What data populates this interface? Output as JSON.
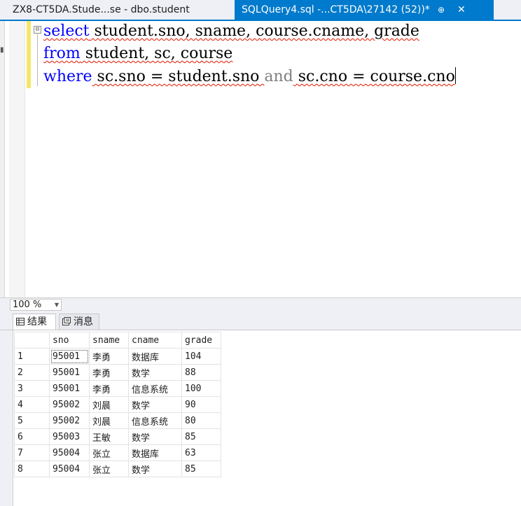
{
  "tabs": {
    "inactive": {
      "title": "ZX8-CT5DA.Stude...se - dbo.student"
    },
    "active": {
      "title": "SQLQuery4.sql -...CT5DA\\27142 (52))*",
      "pin": "⊕",
      "close": "✕"
    }
  },
  "editor": {
    "fold_symbol": "⊟",
    "line1": {
      "kw": "select",
      "rest": " student.sno, sname, course.cname, grade"
    },
    "line2": {
      "kw": "from",
      "rest": " student, sc, course"
    },
    "line3": {
      "kw": "where",
      "part1": " sc.sno = student.sno ",
      "and": "and",
      "part2": " sc.cno = course.cno"
    }
  },
  "zoom": {
    "value": "100 %"
  },
  "results_tabs": {
    "results": {
      "label": "结果",
      "icon": "grid-icon"
    },
    "messages": {
      "label": "消息",
      "icon": "messages-icon"
    }
  },
  "grid": {
    "columns": [
      "",
      "sno",
      "sname",
      "cname",
      "grade"
    ],
    "rows": [
      [
        "1",
        "95001",
        "李勇",
        "数据库",
        "104"
      ],
      [
        "2",
        "95001",
        "李勇",
        "数学",
        "88"
      ],
      [
        "3",
        "95001",
        "李勇",
        "信息系统",
        "100"
      ],
      [
        "4",
        "95002",
        "刘晨",
        "数学",
        "90"
      ],
      [
        "5",
        "95002",
        "刘晨",
        "信息系统",
        "80"
      ],
      [
        "6",
        "95003",
        "王敏",
        "数学",
        "85"
      ],
      [
        "7",
        "95004",
        "张立",
        "数据库",
        "63"
      ],
      [
        "8",
        "95004",
        "张立",
        "数学",
        "85"
      ]
    ]
  },
  "colors": {
    "accent": "#007acc",
    "keyword": "#0000ff",
    "squiggle": "#e51400"
  }
}
